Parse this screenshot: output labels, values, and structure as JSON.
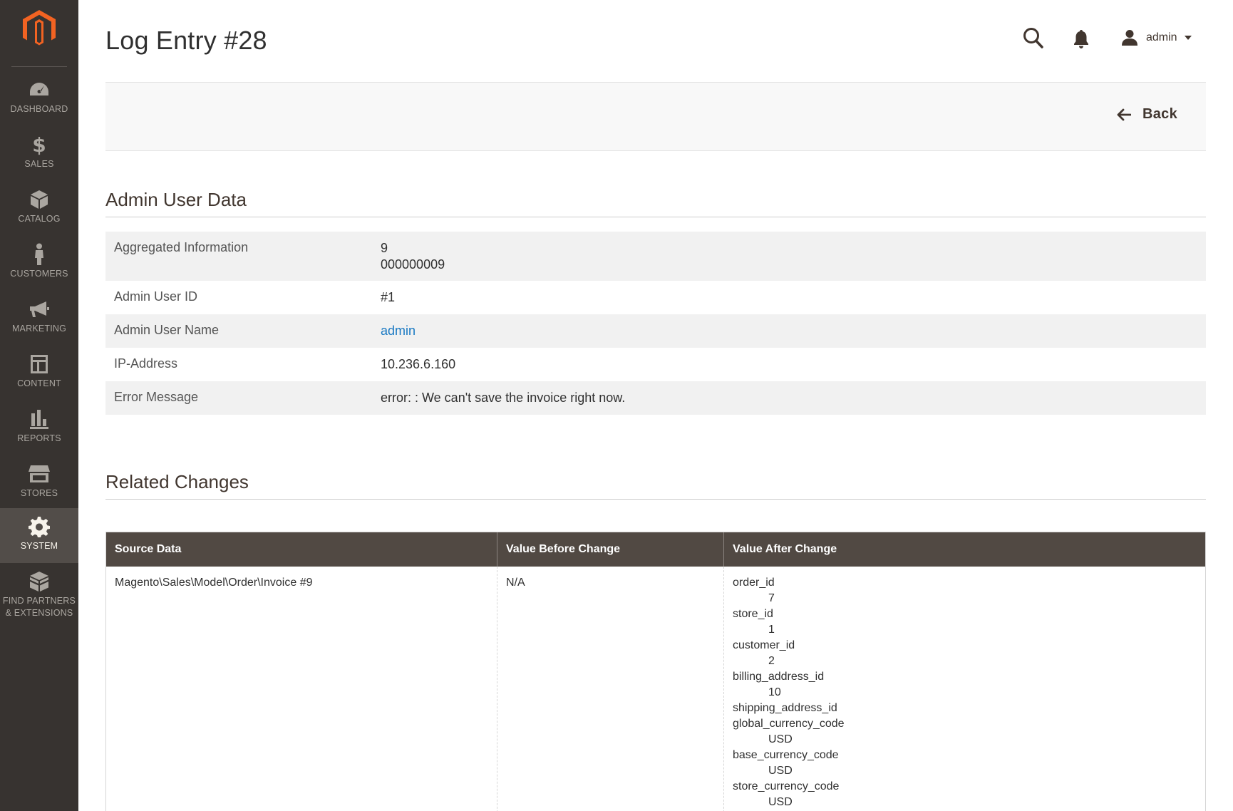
{
  "page": {
    "title": "Log Entry #28"
  },
  "header": {
    "user_name": "admin"
  },
  "action_bar": {
    "back_label": "Back"
  },
  "sidebar": {
    "items": [
      {
        "label": "DASHBOARD",
        "icon": "dashboard-icon"
      },
      {
        "label": "SALES",
        "icon": "dollar-icon"
      },
      {
        "label": "CATALOG",
        "icon": "box-icon"
      },
      {
        "label": "CUSTOMERS",
        "icon": "person-icon"
      },
      {
        "label": "MARKETING",
        "icon": "megaphone-icon"
      },
      {
        "label": "CONTENT",
        "icon": "layout-icon"
      },
      {
        "label": "REPORTS",
        "icon": "bar-chart-icon"
      },
      {
        "label": "STORES",
        "icon": "storefront-icon"
      },
      {
        "label": "SYSTEM",
        "icon": "gear-icon",
        "active": true
      },
      {
        "label": "FIND PARTNERS\n& EXTENSIONS",
        "label_line1": "FIND PARTNERS",
        "label_line2": "& EXTENSIONS",
        "icon": "extensions-icon"
      }
    ],
    "colors": {
      "background": "#373330",
      "active": "#524d49",
      "logo": "#f26322"
    }
  },
  "admin_user_data": {
    "title": "Admin User Data",
    "rows": [
      {
        "label": "Aggregated Information",
        "value_line1": "9",
        "value_line2": "000000009"
      },
      {
        "label": "Admin User ID",
        "value": "#1"
      },
      {
        "label": "Admin User Name",
        "value": "admin",
        "is_link": true
      },
      {
        "label": "IP-Address",
        "value": "10.236.6.160"
      },
      {
        "label": "Error Message",
        "value": "error: : We can't save the invoice right now."
      }
    ]
  },
  "related_changes": {
    "title": "Related Changes",
    "columns": [
      "Source Data",
      "Value Before Change",
      "Value After Change"
    ],
    "rows": [
      {
        "source": "Magento\\Sales\\Model\\Order\\Invoice #9",
        "before": "N/A",
        "after": [
          {
            "key": "order_id",
            "value": "7"
          },
          {
            "key": "store_id",
            "value": "1"
          },
          {
            "key": "customer_id",
            "value": "2"
          },
          {
            "key": "billing_address_id",
            "value": "10"
          },
          {
            "key": "shipping_address_id",
            "value": ""
          },
          {
            "key": "global_currency_code",
            "value": "USD"
          },
          {
            "key": "base_currency_code",
            "value": "USD"
          },
          {
            "key": "store_currency_code",
            "value": "USD"
          }
        ]
      }
    ]
  },
  "colors": {
    "grid_header": "#514943",
    "link": "#1979c3"
  }
}
